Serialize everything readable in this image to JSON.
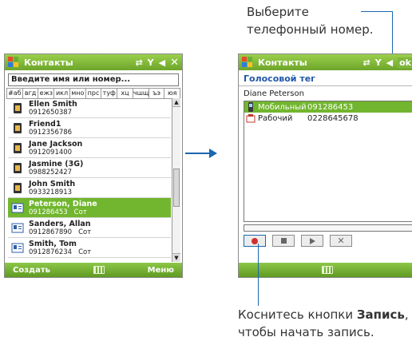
{
  "annotations": {
    "top_right_line1": "Выберите",
    "top_right_line2": "телефонный номер.",
    "bottom_line1_prefix": "Коснитесь кнопки ",
    "bottom_line1_bold": "Запись",
    "bottom_line1_suffix": ",",
    "bottom_line2": "чтобы начать запись.",
    "arrow": "→"
  },
  "left_screen": {
    "title": "Контакты",
    "search_placeholder": "Введите имя или номер...",
    "alpha_groups": [
      "#аб",
      "вгд",
      "ежз",
      "икл",
      "мно",
      "прс",
      "туф",
      "хц",
      "чшщ",
      "ъэ",
      "юя"
    ],
    "contacts": [
      {
        "name": "Ellen Smith",
        "number": "0912650387",
        "kind": "",
        "selected": false
      },
      {
        "name": "Friend1",
        "number": "0912356786",
        "kind": "",
        "selected": false
      },
      {
        "name": "Jane Jackson",
        "number": "0912091400",
        "kind": "",
        "selected": false
      },
      {
        "name": "Jasmine (3G)",
        "number": "0988252427",
        "kind": "",
        "selected": false
      },
      {
        "name": "John Smith",
        "number": "0933218913",
        "kind": "",
        "selected": false
      },
      {
        "name": "Peterson, Diane",
        "number": "091286453",
        "kind": "Сот",
        "selected": true
      },
      {
        "name": "Sanders, Allan",
        "number": "0912867890",
        "kind": "Сот",
        "selected": false
      },
      {
        "name": "Smith, Tom",
        "number": "0912876234",
        "kind": "Сот",
        "selected": false
      }
    ],
    "softkey_left": "Создать",
    "softkey_right": "Меню"
  },
  "right_screen": {
    "title": "Контакты",
    "ok_label": "ok",
    "heading": "Голосовой тег",
    "person": "Diane Peterson",
    "numbers": [
      {
        "label": "Мобильный",
        "number": "091286453",
        "selected": true
      },
      {
        "label": "Рабочий",
        "number": "0228645678",
        "selected": false
      }
    ],
    "recording_progress": 0
  },
  "colors": {
    "titlebar_green": "#6da52b",
    "selection_green": "#71b62e",
    "accent_blue": "#1b67b0",
    "heading_blue": "#1f56a8"
  }
}
